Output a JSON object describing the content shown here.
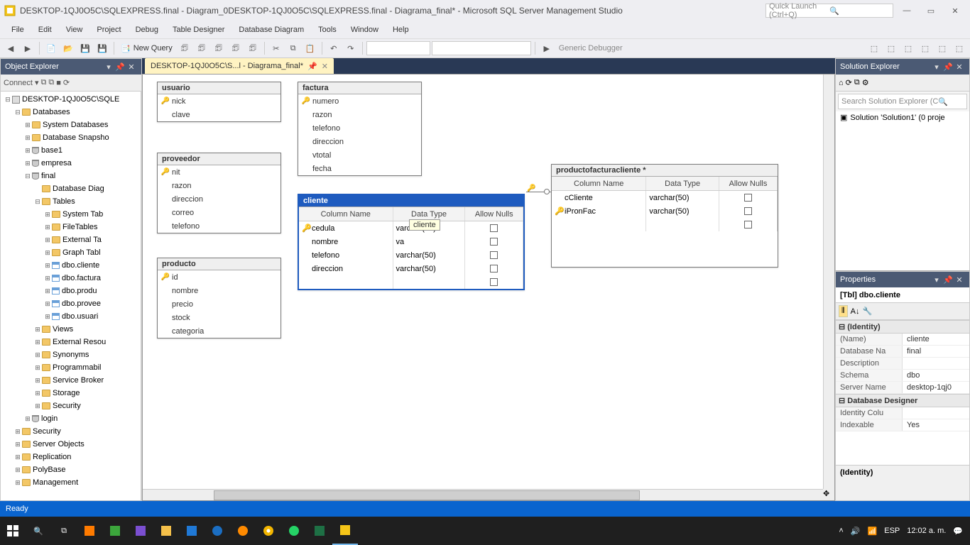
{
  "title": "DESKTOP-1QJ0O5C\\SQLEXPRESS.final - Diagram_0DESKTOP-1QJ0O5C\\SQLEXPRESS.final - Diagrama_final* - Microsoft SQL Server Management Studio",
  "quick_launch_placeholder": "Quick Launch (Ctrl+Q)",
  "menu": [
    "File",
    "Edit",
    "View",
    "Project",
    "Debug",
    "Table Designer",
    "Database Diagram",
    "Tools",
    "Window",
    "Help"
  ],
  "toolbar": {
    "new_query": "New Query",
    "debugger": "Generic Debugger"
  },
  "object_explorer": {
    "title": "Object Explorer",
    "connect_label": "Connect",
    "nodes": [
      {
        "depth": 0,
        "twisty": "−",
        "icon": "server",
        "label": "DESKTOP-1QJ0O5C\\SQLE"
      },
      {
        "depth": 1,
        "twisty": "−",
        "icon": "folder",
        "label": "Databases"
      },
      {
        "depth": 2,
        "twisty": "+",
        "icon": "folder",
        "label": "System Databases"
      },
      {
        "depth": 2,
        "twisty": "+",
        "icon": "folder",
        "label": "Database Snapsho"
      },
      {
        "depth": 2,
        "twisty": "+",
        "icon": "db",
        "label": "base1"
      },
      {
        "depth": 2,
        "twisty": "+",
        "icon": "db",
        "label": "empresa"
      },
      {
        "depth": 2,
        "twisty": "−",
        "icon": "db",
        "label": "final"
      },
      {
        "depth": 3,
        "twisty": "",
        "icon": "folder",
        "label": "Database Diag"
      },
      {
        "depth": 3,
        "twisty": "−",
        "icon": "folder",
        "label": "Tables"
      },
      {
        "depth": 4,
        "twisty": "+",
        "icon": "folder",
        "label": "System Tab"
      },
      {
        "depth": 4,
        "twisty": "+",
        "icon": "folder",
        "label": "FileTables"
      },
      {
        "depth": 4,
        "twisty": "+",
        "icon": "folder",
        "label": "External Ta"
      },
      {
        "depth": 4,
        "twisty": "+",
        "icon": "folder",
        "label": "Graph Tabl"
      },
      {
        "depth": 4,
        "twisty": "+",
        "icon": "table",
        "label": "dbo.cliente"
      },
      {
        "depth": 4,
        "twisty": "+",
        "icon": "table",
        "label": "dbo.factura"
      },
      {
        "depth": 4,
        "twisty": "+",
        "icon": "table",
        "label": "dbo.produ"
      },
      {
        "depth": 4,
        "twisty": "+",
        "icon": "table",
        "label": "dbo.provee"
      },
      {
        "depth": 4,
        "twisty": "+",
        "icon": "table",
        "label": "dbo.usuari"
      },
      {
        "depth": 3,
        "twisty": "+",
        "icon": "folder",
        "label": "Views"
      },
      {
        "depth": 3,
        "twisty": "+",
        "icon": "folder",
        "label": "External Resou"
      },
      {
        "depth": 3,
        "twisty": "+",
        "icon": "folder",
        "label": "Synonyms"
      },
      {
        "depth": 3,
        "twisty": "+",
        "icon": "folder",
        "label": "Programmabil"
      },
      {
        "depth": 3,
        "twisty": "+",
        "icon": "folder",
        "label": "Service Broker"
      },
      {
        "depth": 3,
        "twisty": "+",
        "icon": "folder",
        "label": "Storage"
      },
      {
        "depth": 3,
        "twisty": "+",
        "icon": "folder",
        "label": "Security"
      },
      {
        "depth": 2,
        "twisty": "+",
        "icon": "db",
        "label": "login"
      },
      {
        "depth": 1,
        "twisty": "+",
        "icon": "folder",
        "label": "Security"
      },
      {
        "depth": 1,
        "twisty": "+",
        "icon": "folder",
        "label": "Server Objects"
      },
      {
        "depth": 1,
        "twisty": "+",
        "icon": "folder",
        "label": "Replication"
      },
      {
        "depth": 1,
        "twisty": "+",
        "icon": "folder",
        "label": "PolyBase"
      },
      {
        "depth": 1,
        "twisty": "+",
        "icon": "folder",
        "label": "Management"
      }
    ]
  },
  "tab_label": "DESKTOP-1QJ0O5C\\S...l - Diagrama_final*",
  "diagram_tables": {
    "usuario": {
      "name": "usuario",
      "cols": [
        {
          "k": true,
          "n": "nick"
        },
        {
          "k": false,
          "n": "clave"
        }
      ]
    },
    "proveedor": {
      "name": "proveedor",
      "cols": [
        {
          "k": true,
          "n": "nit"
        },
        {
          "k": false,
          "n": "razon"
        },
        {
          "k": false,
          "n": "direccion"
        },
        {
          "k": false,
          "n": "correo"
        },
        {
          "k": false,
          "n": "telefono"
        }
      ]
    },
    "producto": {
      "name": "producto",
      "cols": [
        {
          "k": true,
          "n": "id"
        },
        {
          "k": false,
          "n": "nombre"
        },
        {
          "k": false,
          "n": "precio"
        },
        {
          "k": false,
          "n": "stock"
        },
        {
          "k": false,
          "n": "categoria"
        }
      ]
    },
    "factura": {
      "name": "factura",
      "cols": [
        {
          "k": true,
          "n": "numero"
        },
        {
          "k": false,
          "n": "razon"
        },
        {
          "k": false,
          "n": "telefono"
        },
        {
          "k": false,
          "n": "direccion"
        },
        {
          "k": false,
          "n": "vtotal"
        },
        {
          "k": false,
          "n": "fecha"
        }
      ]
    },
    "cliente": {
      "name": "cliente",
      "headers": {
        "c1": "Column Name",
        "c2": "Data Type",
        "c3": "Allow Nulls"
      },
      "rows": [
        {
          "k": true,
          "n": "cedula",
          "t": "varchar(50)"
        },
        {
          "k": false,
          "n": "nombre",
          "t": "va"
        },
        {
          "k": false,
          "n": "telefono",
          "t": "varchar(50)"
        },
        {
          "k": false,
          "n": "direccion",
          "t": "varchar(50)"
        }
      ],
      "tooltip": "cliente"
    },
    "productofacturacliente": {
      "name": "productofacturacliente *",
      "headers": {
        "c1": "Column Name",
        "c2": "Data Type",
        "c3": "Allow Nulls"
      },
      "rows": [
        {
          "k": false,
          "n": "cCliente",
          "t": "varchar(50)"
        },
        {
          "k": true,
          "n": "iPronFac",
          "t": "varchar(50)"
        }
      ]
    }
  },
  "solution_explorer": {
    "title": "Solution Explorer",
    "search_placeholder": "Search Solution Explorer (C",
    "item": "Solution 'Solution1' (0 proje"
  },
  "properties": {
    "title": "Properties",
    "target": "[Tbl] dbo.cliente",
    "cats": [
      {
        "name": "(Identity)",
        "rows": [
          {
            "n": "(Name)",
            "v": "cliente"
          },
          {
            "n": "Database Na",
            "v": "final"
          },
          {
            "n": "Description",
            "v": ""
          },
          {
            "n": "Schema",
            "v": "dbo"
          },
          {
            "n": "Server Name",
            "v": "desktop-1qj0"
          }
        ]
      },
      {
        "name": "Database Designer",
        "rows": [
          {
            "n": "Identity Colu",
            "v": ""
          },
          {
            "n": "Indexable",
            "v": "Yes"
          }
        ]
      }
    ],
    "help": "(Identity)"
  },
  "status": "Ready",
  "taskbar": {
    "lang": "ESP",
    "time": "12:02 a. m."
  }
}
